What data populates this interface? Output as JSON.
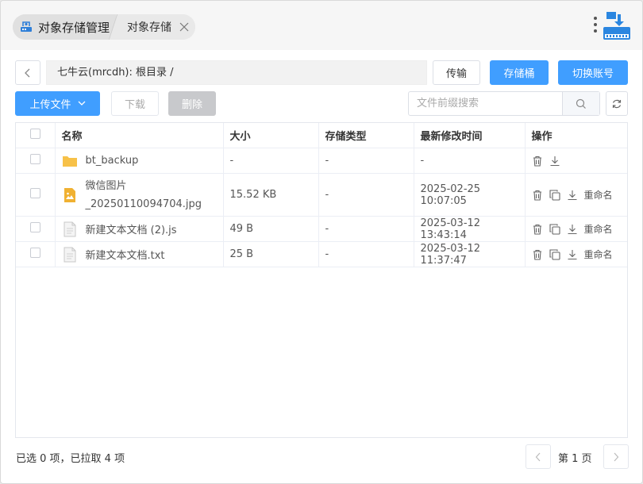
{
  "titlebar": {
    "app_tab": "对象存储管理",
    "sub_tab": "对象存储"
  },
  "toolbar": {
    "path": "七牛云(mrcdh):  根目录 /",
    "transfer_label": "传输",
    "bucket_label": "存储桶",
    "switch_account_label": "切换账号",
    "upload_label": "上传文件",
    "download_label": "下载",
    "delete_label": "删除",
    "search_placeholder": "文件前缀搜索"
  },
  "table": {
    "columns": [
      "名称",
      "大小",
      "存储类型",
      "最新修改时间",
      "操作"
    ],
    "rows": [
      {
        "name": "bt_backup",
        "size": "-",
        "storage": "-",
        "modified": "-",
        "type": "folder"
      },
      {
        "name_line1": "微信图片",
        "name_line2": "_20250110094704.jpg",
        "size": "15.52 KB",
        "storage": "-",
        "modified": "2025-02-25 10:07:05",
        "type": "image"
      },
      {
        "name": "新建文本文档 (2).js",
        "size": "49 B",
        "storage": "-",
        "modified": "2025-03-12 13:43:14",
        "type": "file"
      },
      {
        "name": "新建文本文档.txt",
        "size": "25 B",
        "storage": "-",
        "modified": "2025-03-12 11:37:47",
        "type": "file"
      }
    ],
    "rename_label": "重命名"
  },
  "footer": {
    "status": "已选 0 项，已拉取 4 项",
    "page_label": "第 1 页"
  },
  "colors": {
    "accent": "#409eff",
    "folder": "#f7c148",
    "image": "#f0b132"
  }
}
